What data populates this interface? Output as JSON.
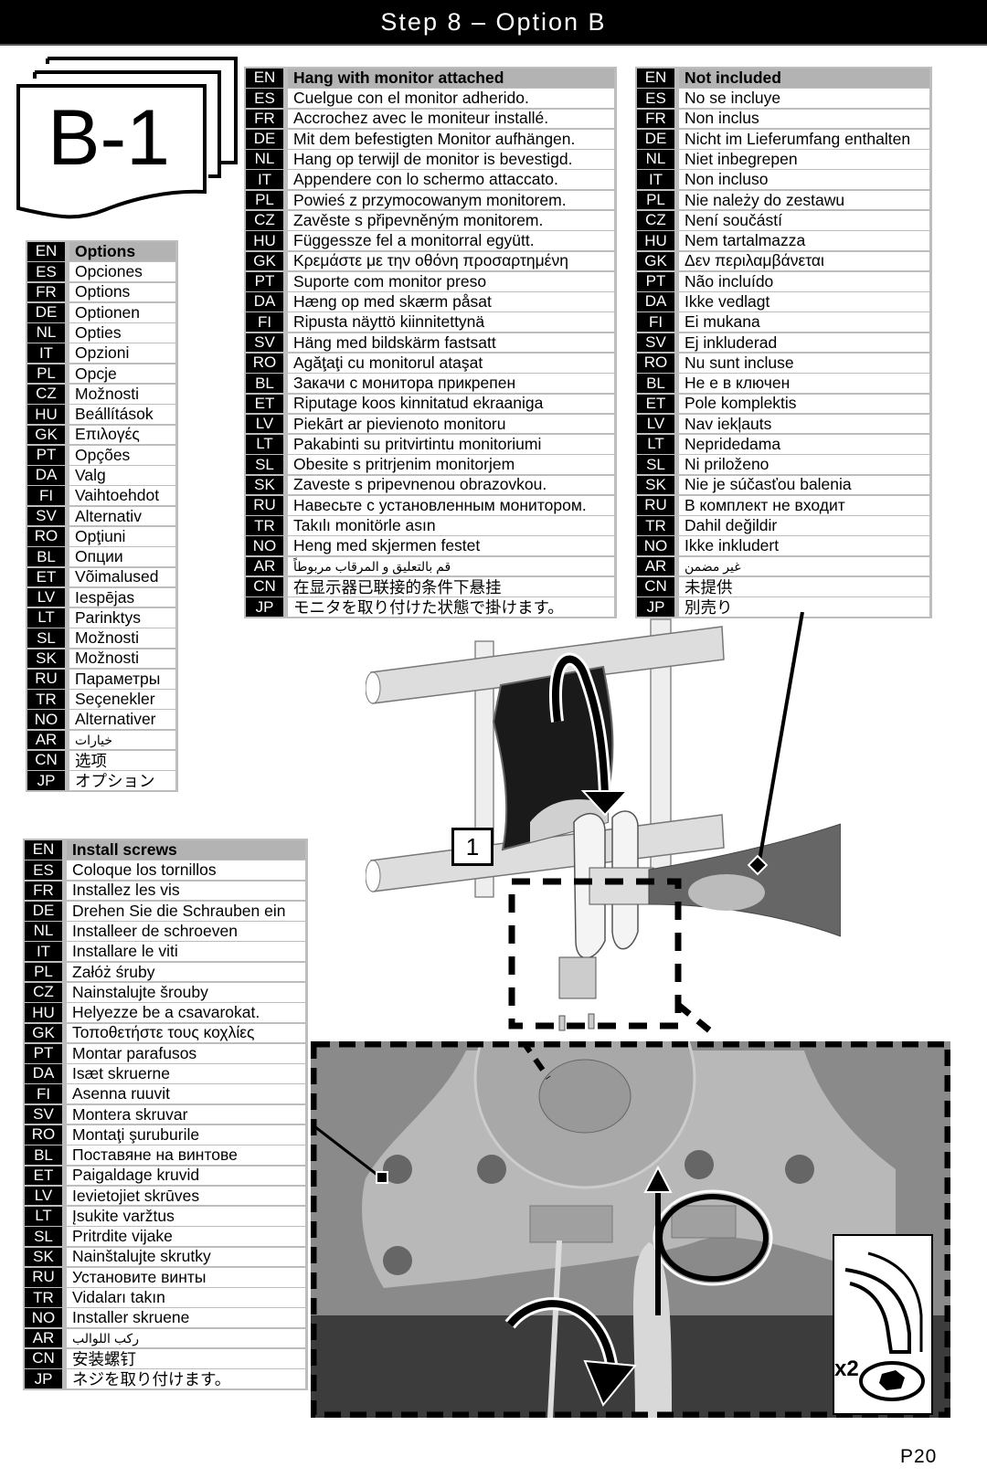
{
  "header": {
    "title": "Step 8 – Option B"
  },
  "badge": {
    "label": "B-1"
  },
  "tables": {
    "options": [
      {
        "code": "EN",
        "text": "Options"
      },
      {
        "code": "ES",
        "text": "Opciones"
      },
      {
        "code": "FR",
        "text": "Options"
      },
      {
        "code": "DE",
        "text": "Optionen"
      },
      {
        "code": "NL",
        "text": "Opties"
      },
      {
        "code": "IT",
        "text": "Opzioni"
      },
      {
        "code": "PL",
        "text": "Opcje"
      },
      {
        "code": "CZ",
        "text": "Možnosti"
      },
      {
        "code": "HU",
        "text": "Beállítások"
      },
      {
        "code": "GK",
        "text": "Επιλογές"
      },
      {
        "code": "PT",
        "text": "Opções"
      },
      {
        "code": "DA",
        "text": "Valg"
      },
      {
        "code": "FI",
        "text": "Vaihtoehdot"
      },
      {
        "code": "SV",
        "text": "Alternativ"
      },
      {
        "code": "RO",
        "text": "Opţiuni"
      },
      {
        "code": "BL",
        "text": "Опции"
      },
      {
        "code": "ET",
        "text": "Võimalused"
      },
      {
        "code": "LV",
        "text": "Iespējas"
      },
      {
        "code": "LT",
        "text": "Parinktys"
      },
      {
        "code": "SL",
        "text": "Možnosti"
      },
      {
        "code": "SK",
        "text": "Možnosti"
      },
      {
        "code": "RU",
        "text": "Параметры"
      },
      {
        "code": "TR",
        "text": "Seçenekler"
      },
      {
        "code": "NO",
        "text": "Alternativer"
      },
      {
        "code": "AR",
        "text": "خيارات"
      },
      {
        "code": "CN",
        "text": "选项"
      },
      {
        "code": "JP",
        "text": "オプション"
      }
    ],
    "hang": [
      {
        "code": "EN",
        "text": "Hang with monitor attached"
      },
      {
        "code": "ES",
        "text": "Cuelgue con el monitor adherido."
      },
      {
        "code": "FR",
        "text": "Accrochez avec le moniteur installé."
      },
      {
        "code": "DE",
        "text": "Mit dem befestigten Monitor aufhängen."
      },
      {
        "code": "NL",
        "text": "Hang op terwijl de monitor is bevestigd."
      },
      {
        "code": "IT",
        "text": "Appendere con lo schermo attaccato."
      },
      {
        "code": "PL",
        "text": "Powieś z przymocowanym monitorem."
      },
      {
        "code": "CZ",
        "text": "Zavěste s připevněným monitorem."
      },
      {
        "code": "HU",
        "text": "Függessze fel a monitorral együtt."
      },
      {
        "code": "GK",
        "text": "Κρεμάστε με την οθόνη προσαρτημένη"
      },
      {
        "code": "PT",
        "text": "Suporte com monitor preso"
      },
      {
        "code": "DA",
        "text": "Hæng op med skærm påsat"
      },
      {
        "code": "FI",
        "text": "Ripusta näyttö kiinnitettynä"
      },
      {
        "code": "SV",
        "text": "Häng med bildskärm fastsatt"
      },
      {
        "code": "RO",
        "text": "Agăţaţi cu monitorul ataşat"
      },
      {
        "code": "BL",
        "text": "Закачи с монитора прикрепен"
      },
      {
        "code": "ET",
        "text": "Riputage koos kinnitatud ekraaniga"
      },
      {
        "code": "LV",
        "text": "Piekārt ar pievienoto monitoru"
      },
      {
        "code": "LT",
        "text": "Pakabinti su pritvirtintu monitoriumi"
      },
      {
        "code": "SL",
        "text": "Obesite s pritrjenim monitorjem"
      },
      {
        "code": "SK",
        "text": "Zaveste s pripevnenou obrazovkou."
      },
      {
        "code": "RU",
        "text": "Навесьте с установленным монитором."
      },
      {
        "code": "TR",
        "text": "Takılı monitörle asın"
      },
      {
        "code": "NO",
        "text": "Heng med skjermen festet"
      },
      {
        "code": "AR",
        "text": "قم بالتعليق و المرقاب مربوطاً"
      },
      {
        "code": "CN",
        "text": "在显示器已联接的条件下悬挂"
      },
      {
        "code": "JP",
        "text": "モニタを取り付けた状態で掛けます。"
      }
    ],
    "not_included": [
      {
        "code": "EN",
        "text": "Not included"
      },
      {
        "code": "ES",
        "text": "No se incluye"
      },
      {
        "code": "FR",
        "text": "Non inclus"
      },
      {
        "code": "DE",
        "text": "Nicht im Lieferumfang enthalten"
      },
      {
        "code": "NL",
        "text": "Niet inbegrepen"
      },
      {
        "code": "IT",
        "text": "Non incluso"
      },
      {
        "code": "PL",
        "text": "Nie należy do zestawu"
      },
      {
        "code": "CZ",
        "text": "Není součástí"
      },
      {
        "code": "HU",
        "text": "Nem tartalmazza"
      },
      {
        "code": "GK",
        "text": "Δεν περιλαμβάνεται"
      },
      {
        "code": "PT",
        "text": "Não incluído"
      },
      {
        "code": "DA",
        "text": "Ikke vedlagt"
      },
      {
        "code": "FI",
        "text": "Ei mukana"
      },
      {
        "code": "SV",
        "text": "Ej inkluderad"
      },
      {
        "code": "RO",
        "text": "Nu sunt incluse"
      },
      {
        "code": "BL",
        "text": "Не е в ключен"
      },
      {
        "code": "ET",
        "text": "Pole komplektis"
      },
      {
        "code": "LV",
        "text": "Nav iekļauts"
      },
      {
        "code": "LT",
        "text": "Nepridedama"
      },
      {
        "code": "SL",
        "text": "Ni priloženo"
      },
      {
        "code": "SK",
        "text": "Nie je súčasťou balenia"
      },
      {
        "code": "RU",
        "text": "В комплект не входит"
      },
      {
        "code": "TR",
        "text": "Dahil değildir"
      },
      {
        "code": "NO",
        "text": "Ikke inkludert"
      },
      {
        "code": "AR",
        "text": "غير مضمن"
      },
      {
        "code": "CN",
        "text": "未提供"
      },
      {
        "code": "JP",
        "text": "別売り"
      }
    ],
    "install_screws": [
      {
        "code": "EN",
        "text": "Install screws"
      },
      {
        "code": "ES",
        "text": "Coloque los tornillos"
      },
      {
        "code": "FR",
        "text": "Installez les vis"
      },
      {
        "code": "DE",
        "text": "Drehen Sie die Schrauben ein"
      },
      {
        "code": "NL",
        "text": "Installeer de schroeven"
      },
      {
        "code": "IT",
        "text": "Installare le viti"
      },
      {
        "code": "PL",
        "text": "Załóż śruby"
      },
      {
        "code": "CZ",
        "text": "Nainstalujte šrouby"
      },
      {
        "code": "HU",
        "text": "Helyezze be a csavarokat."
      },
      {
        "code": "GK",
        "text": "Τοποθετήστε τους κοχλίες"
      },
      {
        "code": "PT",
        "text": "Montar parafusos"
      },
      {
        "code": "DA",
        "text": "Isæt skruerne"
      },
      {
        "code": "FI",
        "text": "Asenna ruuvit"
      },
      {
        "code": "SV",
        "text": "Montera skruvar"
      },
      {
        "code": "RO",
        "text": "Montaţi şuruburile"
      },
      {
        "code": "BL",
        "text": "Поставяне на винтове"
      },
      {
        "code": "ET",
        "text": "Paigaldage kruvid"
      },
      {
        "code": "LV",
        "text": "Ievietojiet skrūves"
      },
      {
        "code": "LT",
        "text": "Įsukite varžtus"
      },
      {
        "code": "SL",
        "text": "Pritrdite vijake"
      },
      {
        "code": "SK",
        "text": "Nainštalujte skrutky"
      },
      {
        "code": "RU",
        "text": "Установите винты"
      },
      {
        "code": "TR",
        "text": "Vidaları takın"
      },
      {
        "code": "NO",
        "text": "Installer skruene"
      },
      {
        "code": "AR",
        "text": "ركب اللوالب"
      },
      {
        "code": "CN",
        "text": "安装螺钉"
      },
      {
        "code": "JP",
        "text": "ネジを取り付けます。"
      }
    ]
  },
  "diagram": {
    "step_number": "1"
  },
  "photo": {
    "quantity_label": "x2"
  },
  "footer": {
    "page_number": "P20"
  },
  "colors": {
    "header_bg": "#000000",
    "table_frame": "#bdbdbd",
    "table_head": "#b3b3b3",
    "code_bg": "#000000"
  }
}
